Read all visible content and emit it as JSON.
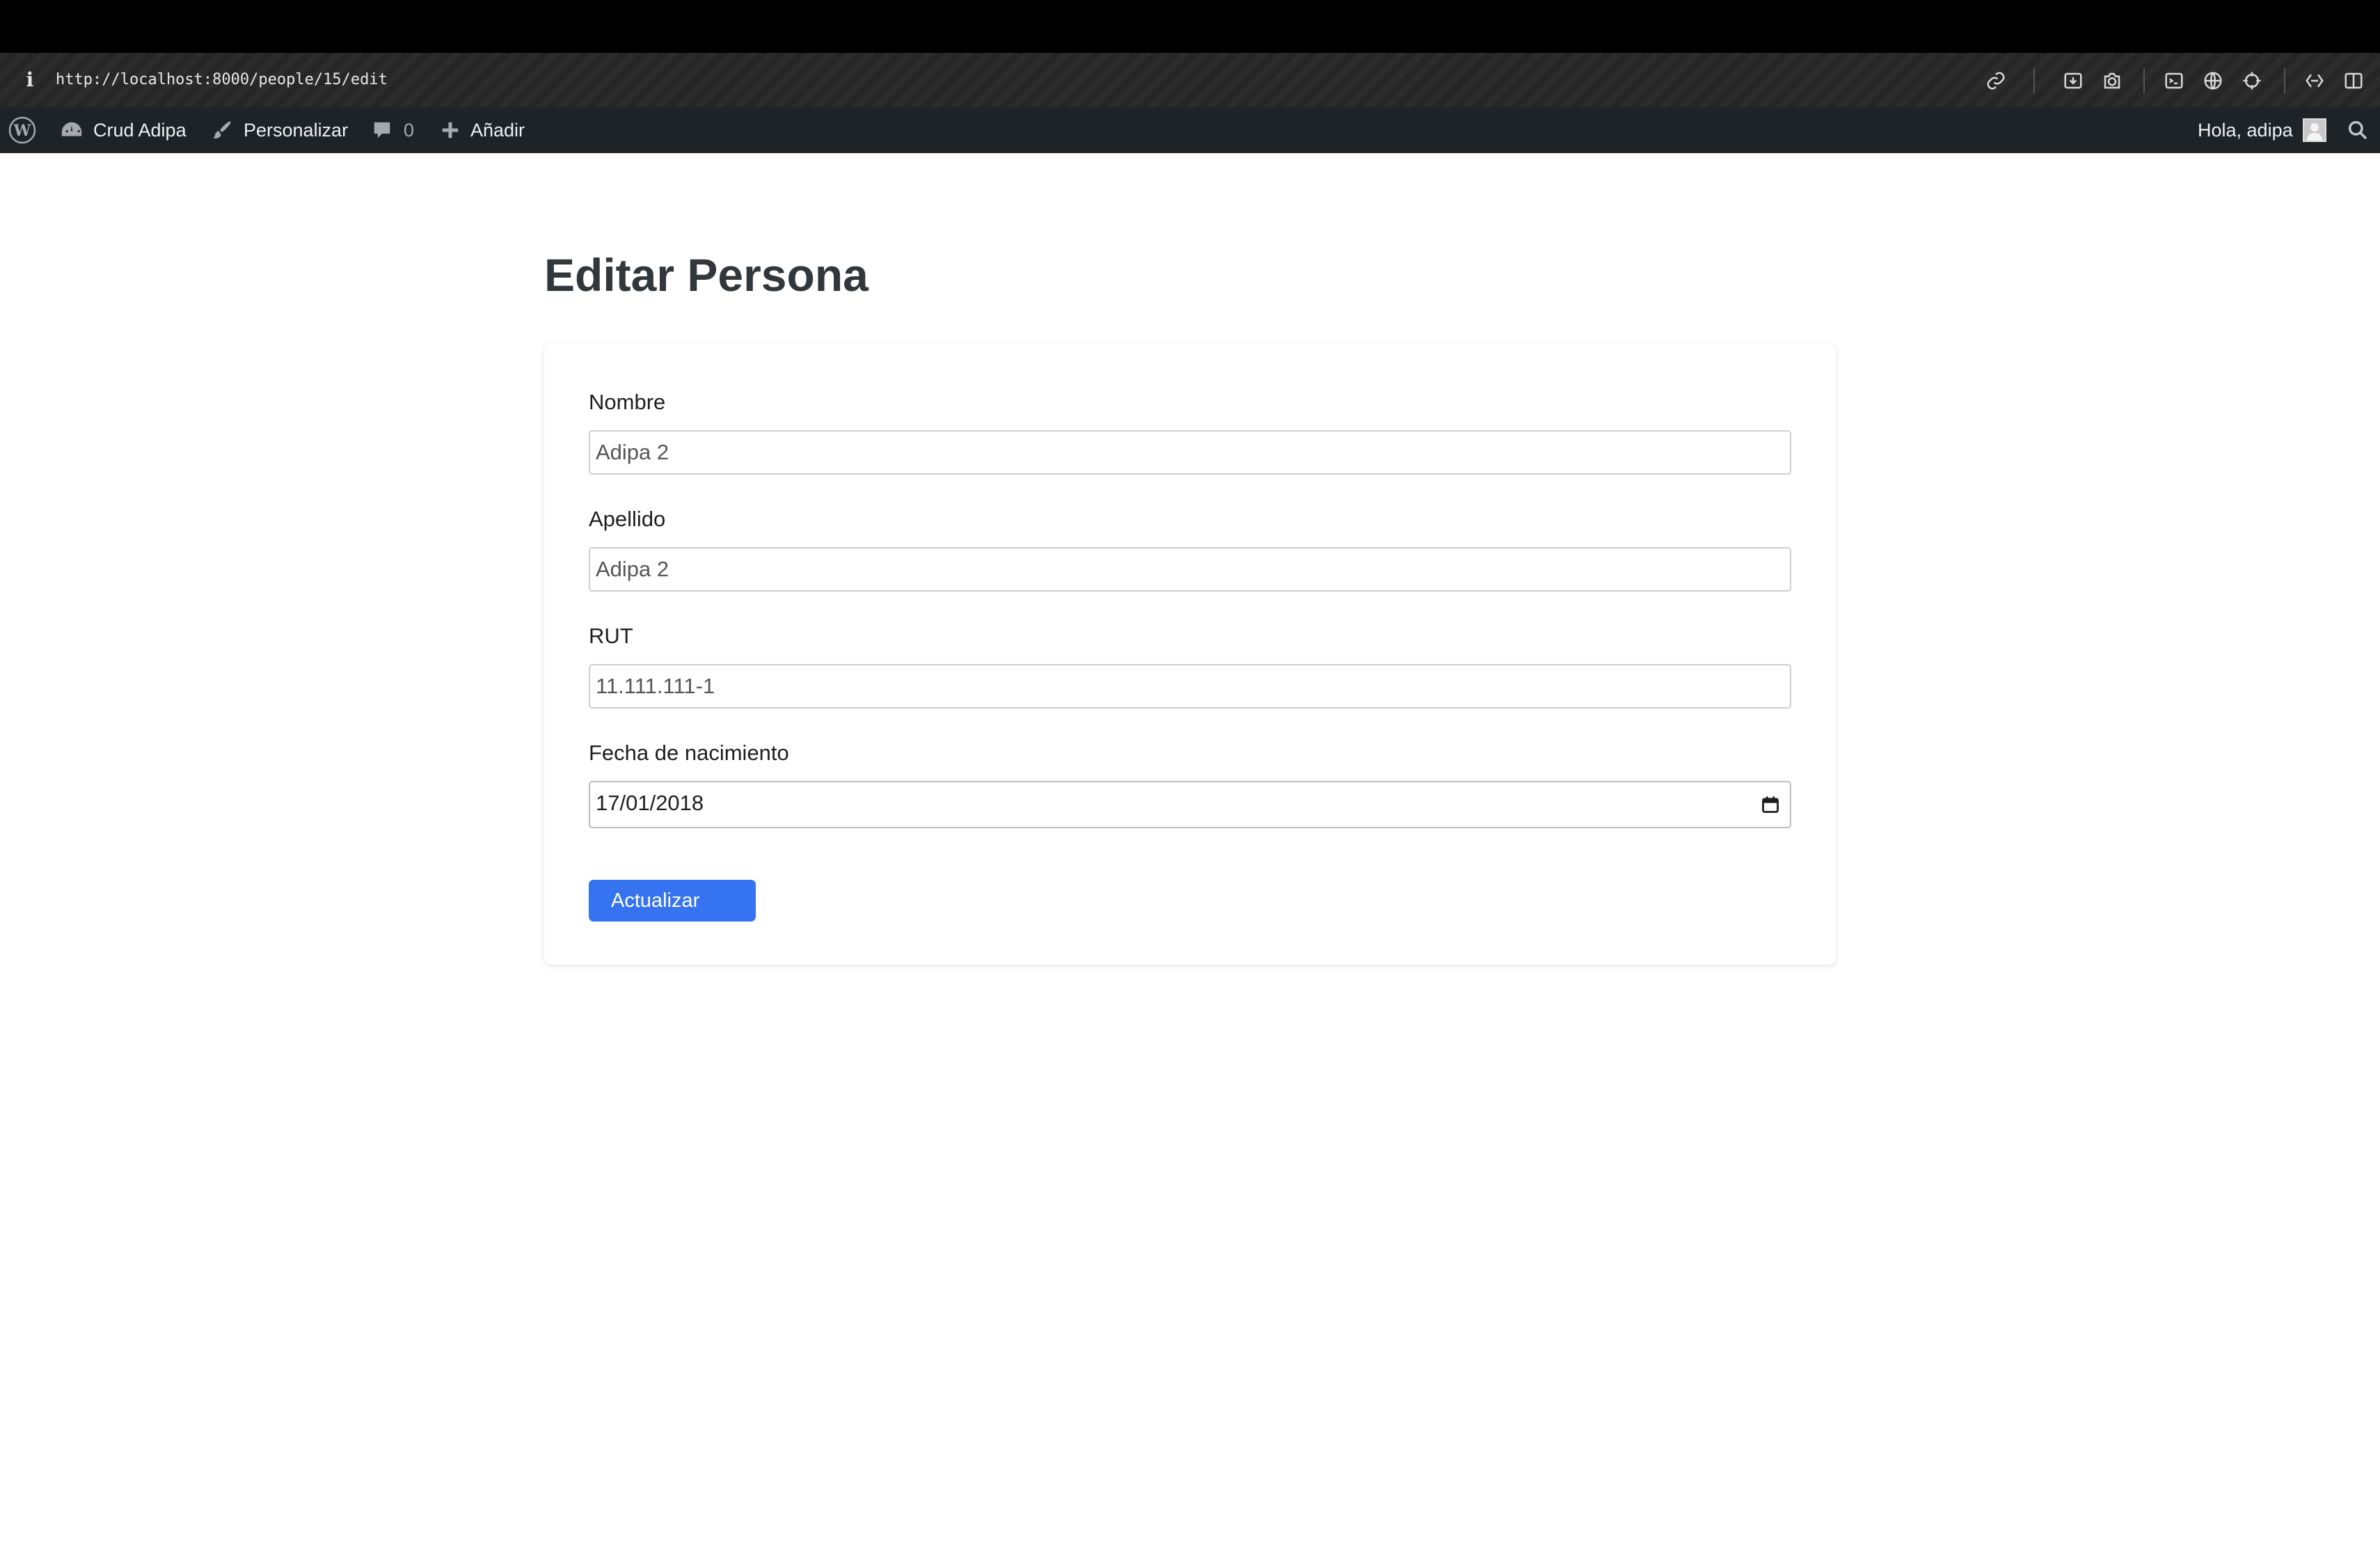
{
  "browser": {
    "url": "http://localhost:8000/people/15/edit",
    "icons": [
      "info-icon",
      "link-icon",
      "download-icon",
      "camera-icon",
      "terminal-icon",
      "globe-icon",
      "crosshair-icon",
      "devtools-icon",
      "sidebar-icon"
    ]
  },
  "adminbar": {
    "site_name": "Crud Adipa",
    "customize_label": "Personalizar",
    "comments_count": "0",
    "add_new_label": "Añadir",
    "greeting": "Hola, adipa"
  },
  "page": {
    "title": "Editar Persona"
  },
  "form": {
    "nombre": {
      "label": "Nombre",
      "value": "Adipa 2"
    },
    "apellido": {
      "label": "Apellido",
      "value": "Adipa 2"
    },
    "rut": {
      "label": "RUT",
      "value": "11.111.111-1"
    },
    "fecha": {
      "label": "Fecha de nacimiento",
      "value": "17/01/2018"
    },
    "submit_label": "Actualizar"
  },
  "colors": {
    "admin_bar": "#1d2327",
    "button": "#3573f0",
    "title": "#32373c"
  }
}
